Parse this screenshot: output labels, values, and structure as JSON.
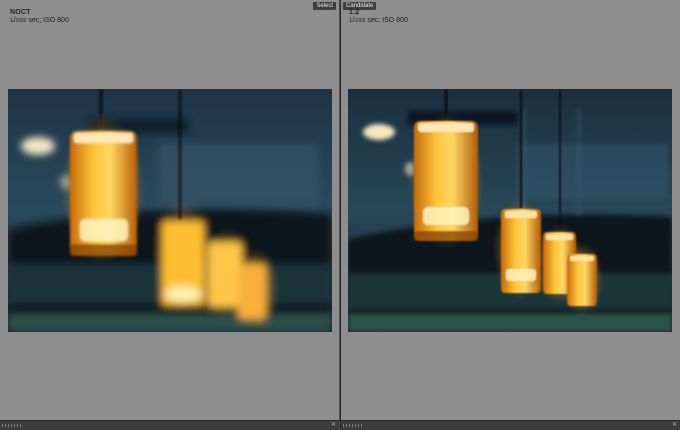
{
  "left": {
    "title": "NOCT",
    "shutter_num": "1",
    "shutter_den": "2000",
    "exposure_rest": " sec; ISO 800",
    "badge": "Select",
    "close_glyph": "✕"
  },
  "right": {
    "title": "1.2",
    "shutter_num": "1",
    "shutter_den": "2000",
    "exposure_rest": " sec; ISO 800",
    "badge": "Candidate",
    "close_glyph": "✕"
  },
  "colors": {
    "panel_bg": "#8e8e8e",
    "divider": "#4a4a4a",
    "badge_bg": "#3e3e3e",
    "lamp_glow": "#ffb020"
  }
}
